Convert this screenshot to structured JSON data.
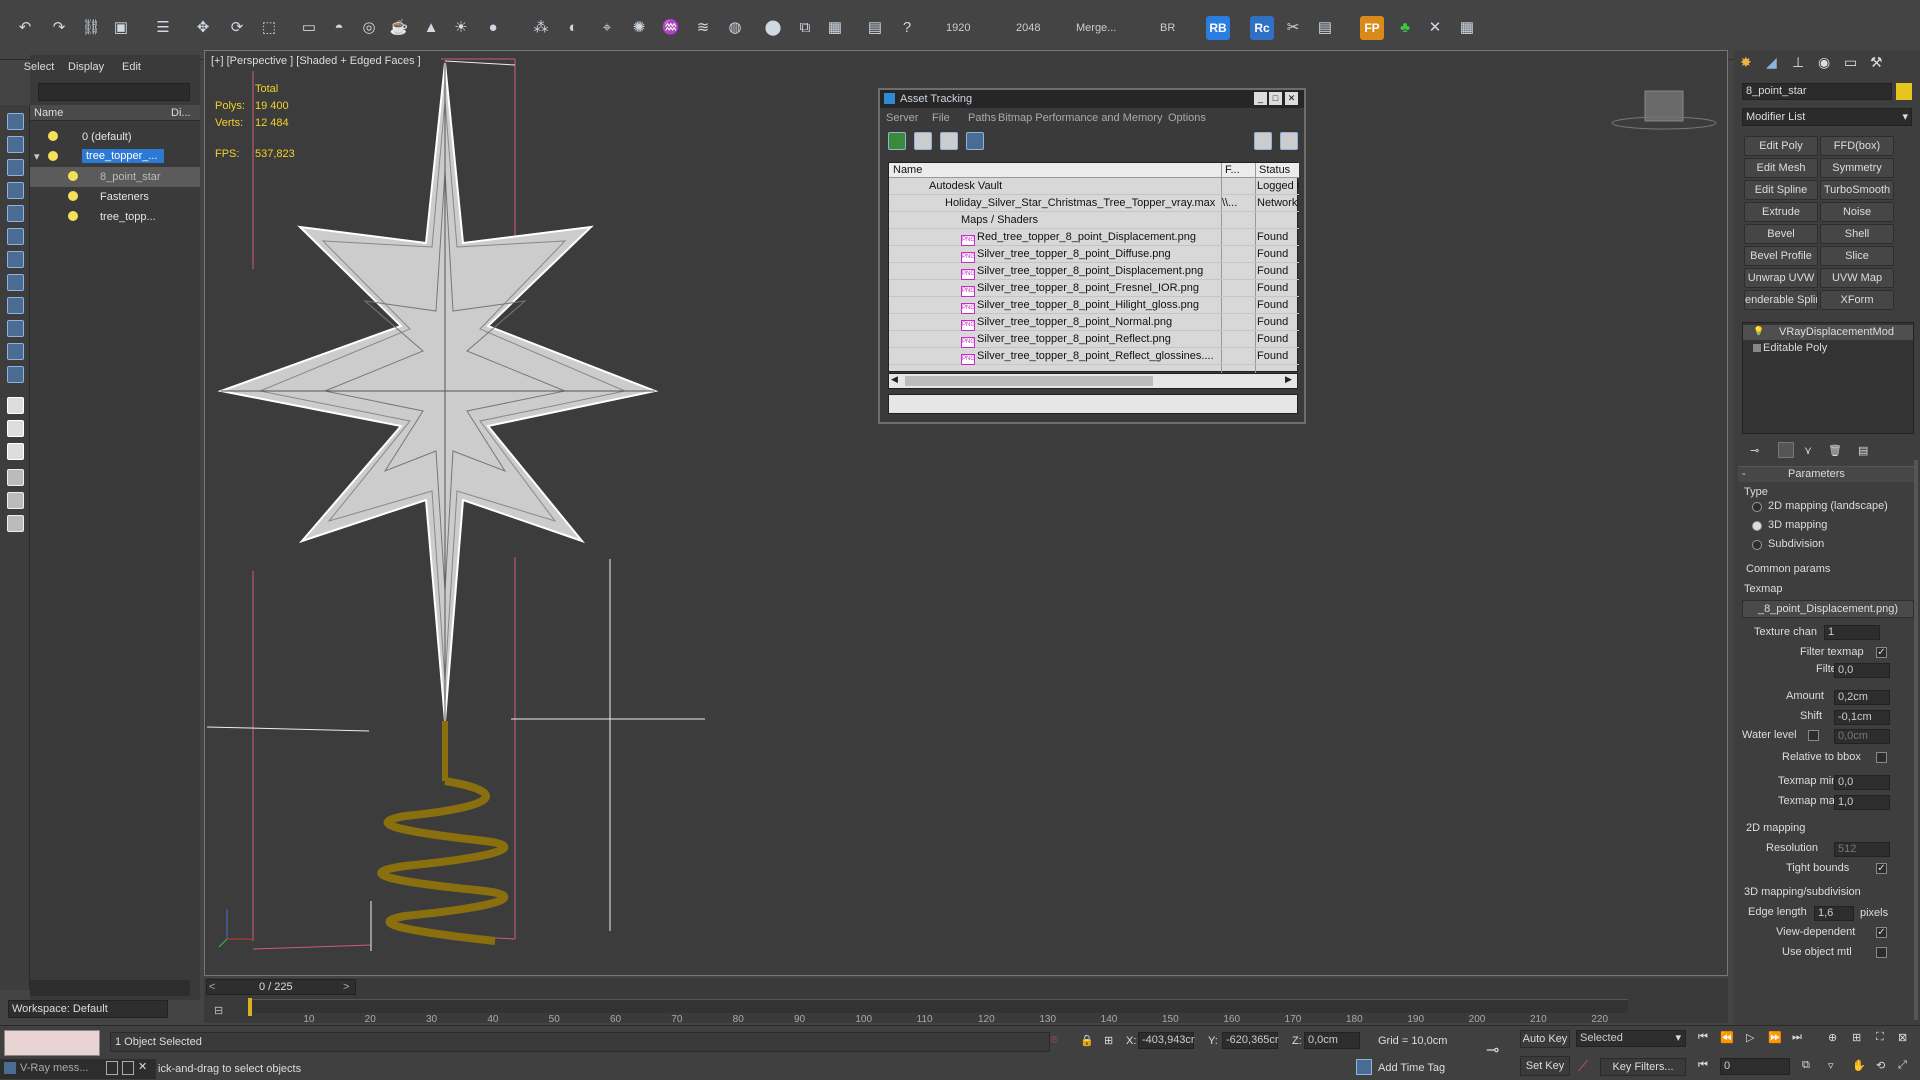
{
  "toolbar": {
    "render_width": "1920",
    "render_height": "2048",
    "merge_label": "Merge...",
    "br_label": "BR",
    "rb_badge": "RB",
    "rc_badge": "Rc",
    "fp_badge": "FP",
    "help_glyph": "?"
  },
  "scene_explorer": {
    "menu": [
      "Select",
      "Display",
      "Edit"
    ],
    "col_name": "Name",
    "col_display": "Di...",
    "rows": [
      {
        "label": "0 (default)"
      },
      {
        "label": "tree_topper_..."
      },
      {
        "label": "8_point_star"
      },
      {
        "label": "Fasteners"
      },
      {
        "label": "tree_topp..."
      }
    ],
    "workspace_label": "Workspace: Default"
  },
  "viewport": {
    "label": "[+] [Perspective ] [Shaded + Edged Faces ]",
    "stats": {
      "total_label": "Total",
      "polys_label": "Polys:",
      "polys_value": "19 400",
      "verts_label": "Verts:",
      "verts_value": "12 484",
      "fps_label": "FPS:",
      "fps_value": "537,823"
    }
  },
  "asset_tracking": {
    "title": "Asset Tracking",
    "menu": [
      "Server",
      "File",
      "Paths",
      "Bitmap Performance and Memory",
      "Options"
    ],
    "columns": {
      "name": "Name",
      "full_path": "F...",
      "status": "Status"
    },
    "rows": [
      {
        "name": "Autodesk Vault",
        "path": "",
        "status": "Logged O"
      },
      {
        "name": "Holiday_Silver_Star_Christmas_Tree_Topper_vray.max",
        "path": "\\\\...",
        "status": "Network"
      },
      {
        "name": "Maps / Shaders",
        "path": "",
        "status": ""
      },
      {
        "name": "Red_tree_topper_8_point_Displacement.png",
        "path": "",
        "status": "Found"
      },
      {
        "name": "Silver_tree_topper_8_point_Diffuse.png",
        "path": "",
        "status": "Found"
      },
      {
        "name": "Silver_tree_topper_8_point_Displacement.png",
        "path": "",
        "status": "Found"
      },
      {
        "name": "Silver_tree_topper_8_point_Fresnel_IOR.png",
        "path": "",
        "status": "Found"
      },
      {
        "name": "Silver_tree_topper_8_point_Hilight_gloss.png",
        "path": "",
        "status": "Found"
      },
      {
        "name": "Silver_tree_topper_8_point_Normal.png",
        "path": "",
        "status": "Found"
      },
      {
        "name": "Silver_tree_topper_8_point_Reflect.png",
        "path": "",
        "status": "Found"
      },
      {
        "name": "Silver_tree_topper_8_point_Reflect_glossines....",
        "path": "",
        "status": "Found"
      }
    ]
  },
  "command_panel": {
    "object_name": "8_point_star",
    "modifier_list": "Modifier List",
    "modifier_buttons": [
      "Edit Poly",
      "FFD(box)",
      "Edit Mesh",
      "Symmetry",
      "Edit Spline",
      "TurboSmooth",
      "Extrude",
      "Noise",
      "Bevel",
      "Shell",
      "Bevel Profile",
      "Slice",
      "Unwrap UVW",
      "UVW Map",
      "enderable Splir",
      "XForm"
    ],
    "stack": [
      "VRayDisplacementMod",
      "Editable Poly"
    ],
    "parameters_title": "Parameters",
    "type_label": "Type",
    "type_options": [
      "2D mapping (landscape)",
      "3D mapping",
      "Subdivision"
    ],
    "common_params_label": "Common params",
    "texmap_label": "Texmap",
    "texmap_value": "_8_point_Displacement.png)",
    "texture_chan_label": "Texture chan",
    "texture_chan_value": "1",
    "filter_texmap_label": "Filter texmap",
    "filter_blur_label": "Filter blur",
    "filter_blur_value": "0,0",
    "amount_label": "Amount",
    "amount_value": "0,2cm",
    "shift_label": "Shift",
    "shift_value": "-0,1cm",
    "water_level_label": "Water level",
    "water_level_value": "0,0cm",
    "relative_bbox_label": "Relative to bbox",
    "texmap_min_label": "Texmap min",
    "texmap_min_value": "0,0",
    "texmap_max_label": "Texmap max",
    "texmap_max_value": "1,0",
    "mapping2d_label": "2D mapping",
    "resolution_label": "Resolution",
    "resolution_value": "512",
    "tight_bounds_label": "Tight bounds",
    "mapping3d_label": "3D mapping/subdivision",
    "edge_length_label": "Edge length",
    "edge_length_value": "1,6",
    "pixels_label": "pixels",
    "view_dependent_label": "View-dependent",
    "use_object_mtl_label": "Use object mtl"
  },
  "timeline": {
    "frame_counter": "0 / 225",
    "ticks": [
      "10",
      "20",
      "30",
      "40",
      "50",
      "60",
      "70",
      "80",
      "90",
      "100",
      "110",
      "120",
      "130",
      "140",
      "150",
      "160",
      "170",
      "180",
      "190",
      "200",
      "210",
      "220"
    ]
  },
  "statusbar": {
    "selection_status": "1 Object Selected",
    "prompt": "ick-and-drag to select objects",
    "vray_label": "V-Ray mess...",
    "x_label": "X:",
    "x_value": "-403,943cr",
    "y_label": "Y:",
    "y_value": "-620,365cr",
    "z_label": "Z:",
    "z_value": "0,0cm",
    "grid_label": "Grid = 10,0cm",
    "add_time_tag": "Add Time Tag",
    "auto_key": "Auto Key",
    "set_key": "Set Key",
    "selected_value": "Selected",
    "key_filters": "Key Filters...",
    "frame_value": "0"
  }
}
